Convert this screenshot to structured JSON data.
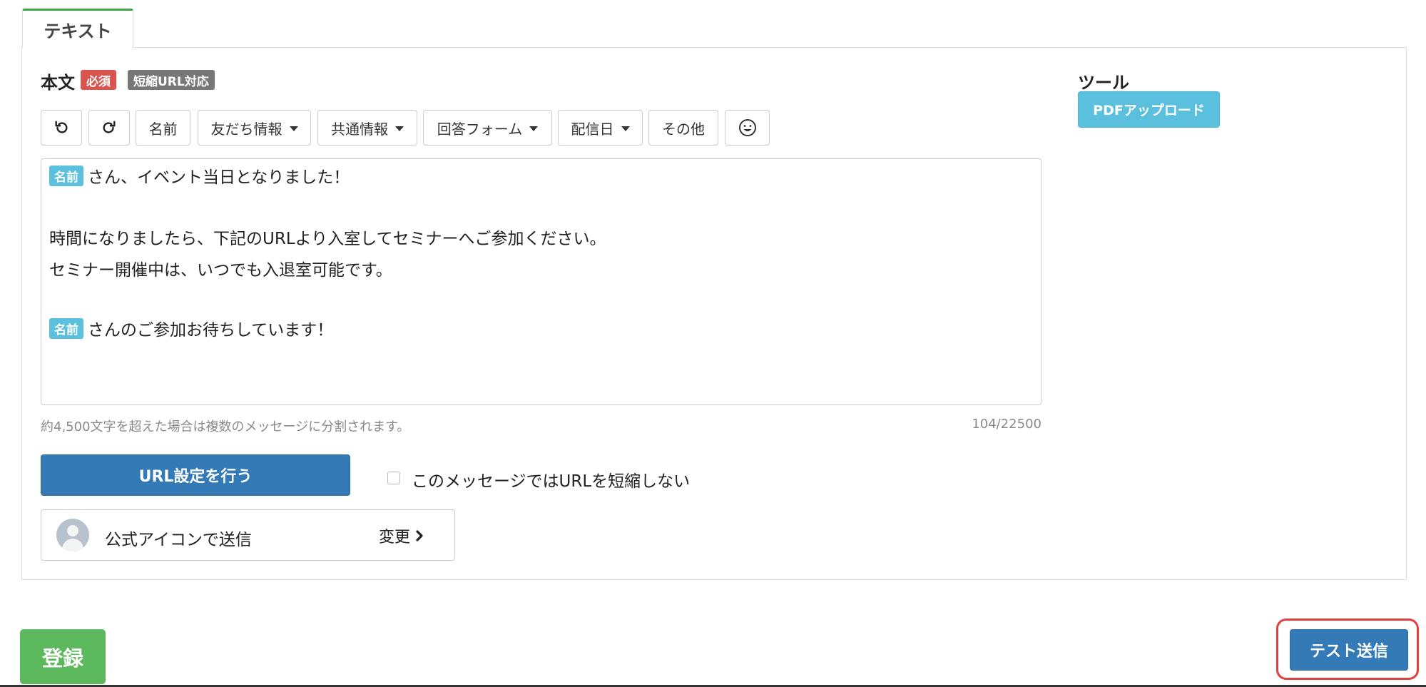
{
  "tab": {
    "label": "テキスト"
  },
  "body": {
    "label": "本文",
    "badge_required": "必須",
    "badge_short_url": "短縮URL対応"
  },
  "tools": {
    "title": "ツール",
    "pdf_upload": "PDFアップロード"
  },
  "toolbar": {
    "undo_icon": "undo-icon",
    "redo_icon": "redo-icon",
    "name": "名前",
    "friend_info": "友だち情報",
    "common_info": "共通情報",
    "answer_form": "回答フォーム",
    "delivery_date": "配信日",
    "other": "その他",
    "emoji_icon": "smile-icon"
  },
  "editor": {
    "name_tag": "名前",
    "line1": "さん、イベント当日となりました！",
    "line2": "時間になりましたら、下記のURLより入室してセミナーへご参加ください。",
    "line3": "セミナー開催中は、いつでも入退室可能です。",
    "line4": "さんのご参加お待ちしています！"
  },
  "help_text": "約4,500文字を超えた場合は複数のメッセージに分割されます。",
  "char_count": "104/22500",
  "url_settings": "URL設定を行う",
  "no_shorten": {
    "label": "このメッセージではURLを短縮しない",
    "checked": false
  },
  "sender": {
    "label": "公式アイコンで送信",
    "change": "変更"
  },
  "register": "登録",
  "test_send": "テスト送信",
  "colors": {
    "tab_accent": "#3aa843",
    "primary": "#337ab7",
    "info": "#5bc0de",
    "success": "#5cb85c",
    "danger": "#d9534f",
    "highlight": "#e04040"
  }
}
